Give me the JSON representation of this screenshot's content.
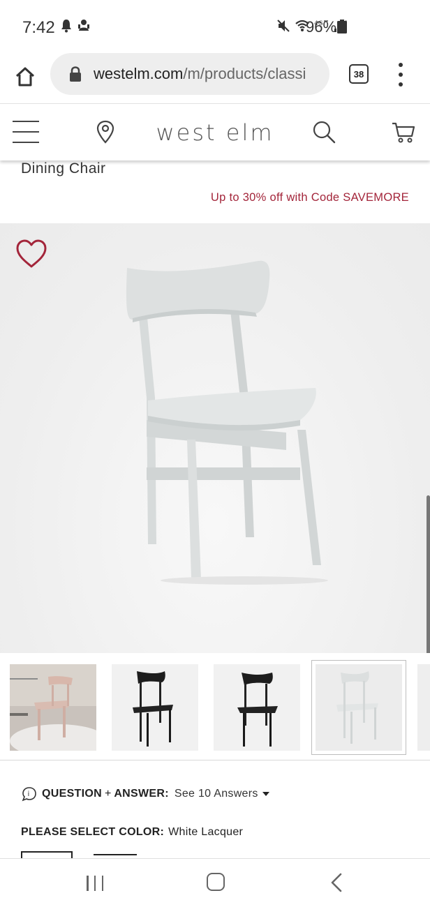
{
  "status_bar": {
    "time": "7:42",
    "battery": "96%",
    "left_icons": [
      "notification-bell-icon",
      "android-activity-icon"
    ],
    "right_icons": [
      "mute-icon",
      "wifi-icon",
      "lte-4g-icon",
      "signal-icon",
      "battery-icon"
    ]
  },
  "browser": {
    "url_host": "westelm.com",
    "url_path": "/m/products/classi",
    "tab_count": "38"
  },
  "header": {
    "brand": "west elm"
  },
  "product": {
    "title": "Dining Chair",
    "promo": "Up to 30% off with Code SAVEMORE"
  },
  "hero": {
    "image": "chair-white-lacquer"
  },
  "thumbnails": [
    {
      "image": "chair-pink-room",
      "selected": false
    },
    {
      "image": "chair-black",
      "selected": false
    },
    {
      "image": "chair-black-front",
      "selected": false
    },
    {
      "image": "chair-white-lacquer",
      "selected": true
    }
  ],
  "qa": {
    "question_label": "QUESTION",
    "plus": "+",
    "answer_label": "ANSWER:",
    "link": "See 10 Answers"
  },
  "color": {
    "label": "PLEASE SELECT COLOR:",
    "value": "White Lacquer"
  },
  "colors": {
    "promo": "#a3253a",
    "heart": "#a3253a",
    "chair": "#dcdfdf"
  }
}
